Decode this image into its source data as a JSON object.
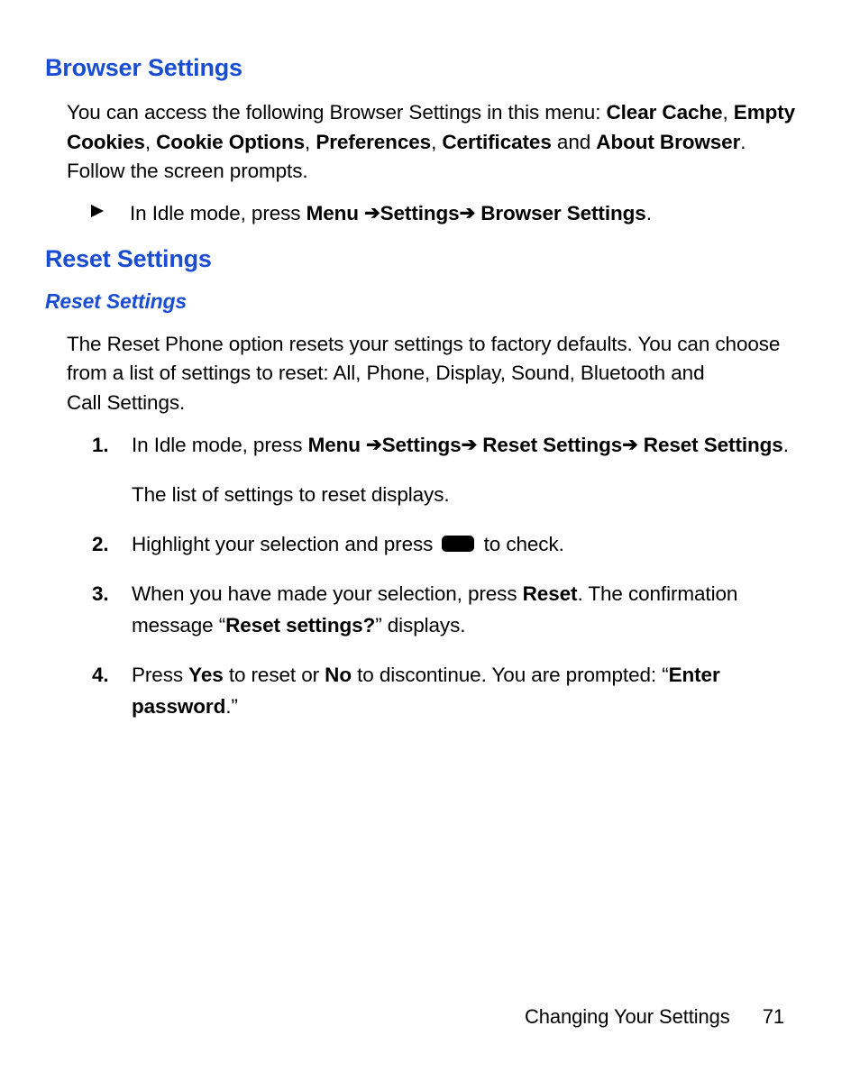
{
  "section1": {
    "heading": "Browser Settings",
    "intro_parts": {
      "p1": "You can access the following Browser Settings in this menu: ",
      "b1": "Clear Cache",
      "c1": ", ",
      "b2": "Empty Cookies",
      "c2": ", ",
      "b3": "Cookie Options",
      "c3": ", ",
      "b4": "Preferences",
      "c4": ", ",
      "b5": "Certificates",
      "c5": " and ",
      "b6": "About Browser",
      "p2": ". Follow the screen prompts."
    },
    "bullet": {
      "pre": "In Idle mode, press ",
      "menu": "Menu ",
      "arrow": " ➔ ",
      "settings": "Settings",
      "browser": "Browser Settings",
      "end": "."
    }
  },
  "section2": {
    "heading": "Reset Settings",
    "subheading": "Reset Settings",
    "intro": "The Reset Phone option resets your settings to factory defaults. You can choose from a list of settings to reset: All, Phone, Display, Sound, Bluetooth and Call Settings.",
    "steps": {
      "s1": {
        "num": "1.",
        "pre": "In Idle mode, press ",
        "menu": "Menu ",
        "arrow": " ➔ ",
        "settings": "Settings",
        "rs": "Reset Settings",
        "end": ".",
        "sub": "The list of settings to reset displays."
      },
      "s2": {
        "num": "2.",
        "pre": "Highlight your selection and press ",
        "post": " to check."
      },
      "s3": {
        "num": "3.",
        "pre": "When you have made your selection, press ",
        "reset": "Reset",
        "mid": ". The confirmation message “",
        "msg": "Reset settings?",
        "end": "” displays."
      },
      "s4": {
        "num": "4.",
        "pre": "Press ",
        "yes": "Yes",
        "mid1": " to reset or ",
        "no": "No",
        "mid2": " to discontinue. You are prompted: “",
        "enter": "Enter password",
        "end": ".”"
      }
    }
  },
  "footer": {
    "chapter": "Changing Your Settings",
    "page": "71"
  }
}
